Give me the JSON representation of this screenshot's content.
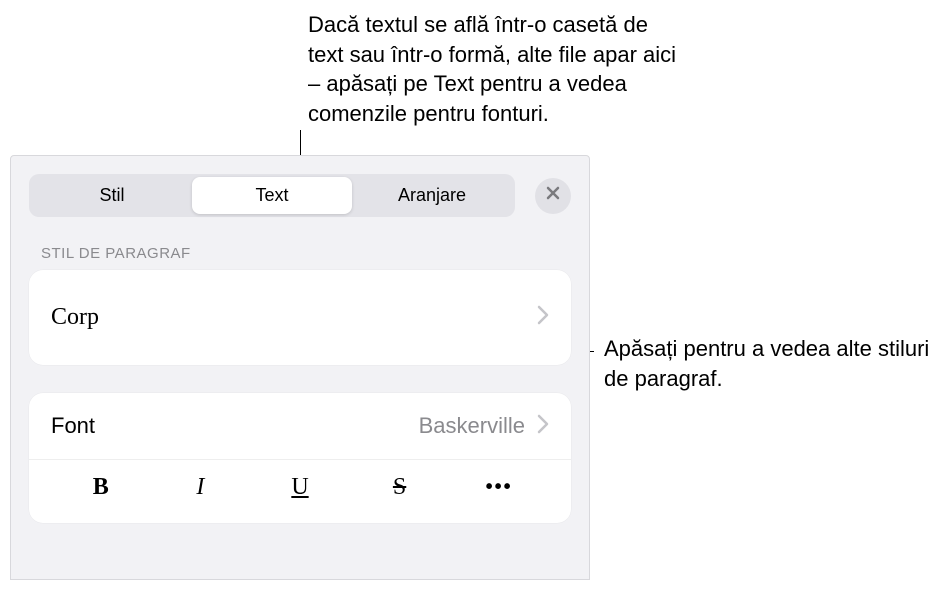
{
  "callouts": {
    "top": "Dacă textul se află într-o casetă de text sau într-o formă, alte file apar aici – apăsați pe Text pentru a vedea comenzile pentru fonturi.",
    "right": "Apăsați pentru a vedea alte stiluri de paragraf."
  },
  "tabs": {
    "stil": "Stil",
    "text": "Text",
    "aranjare": "Aranjare"
  },
  "section": {
    "paragraph_style_header": "STIL DE PARAGRAF",
    "paragraph_style_value": "Corp"
  },
  "font": {
    "label": "Font",
    "value": "Baskerville"
  },
  "styleButtons": {
    "bold": "B",
    "italic": "I",
    "underline": "U",
    "strike": "S",
    "more": "•••"
  }
}
